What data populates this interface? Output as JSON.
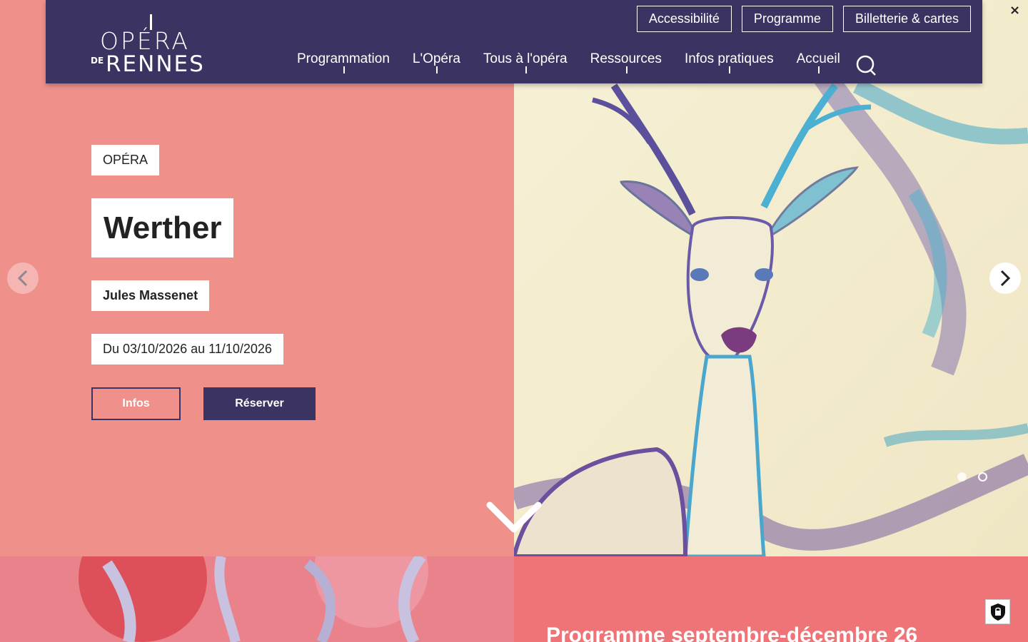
{
  "header": {
    "logo_top": "OPÉRA",
    "logo_de": "DE",
    "logo_bottom": "RENNES",
    "top_links": [
      "Accessibilité",
      "Programme",
      "Billetterie & cartes"
    ],
    "nav": [
      "Programmation",
      "L'Opéra",
      "Tous à l'opéra",
      "Ressources",
      "Infos pratiques",
      "Accueil"
    ]
  },
  "hero": {
    "tag": "OPÉRA",
    "title": "Werther",
    "composer": "Jules Massenet",
    "dates": "Du 03/10/2026 au 11/10/2026",
    "infos_label": "Infos",
    "reserve_label": "Réserver",
    "slide_count": 2,
    "active_slide": 1
  },
  "close_label": "×",
  "bottom": {
    "programme_title": "Programme septembre-décembre 26"
  },
  "colors": {
    "header_bg": "#3b3462",
    "hero_left_bg": "#f0908b",
    "accent": "#3b3462"
  }
}
